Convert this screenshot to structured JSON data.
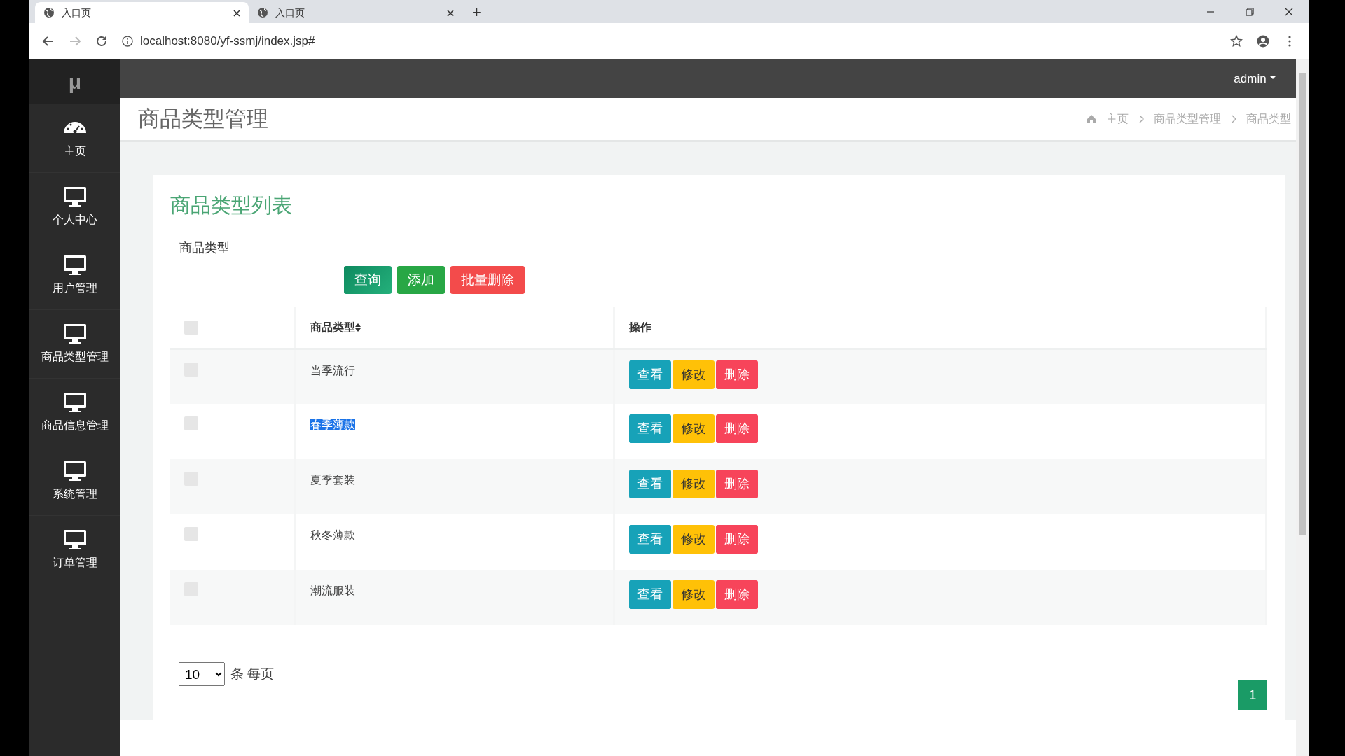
{
  "browser": {
    "tabs": [
      {
        "title": "入口页",
        "selected": true
      },
      {
        "title": "入口页",
        "selected": false
      }
    ],
    "new_tab": "+",
    "url": "localhost:8080/yf-ssmj/index.jsp#"
  },
  "sidebar": {
    "logo": "μ",
    "items": [
      {
        "label": "主页",
        "kind": "dashboard"
      },
      {
        "label": "个人中心",
        "kind": "monitor"
      },
      {
        "label": "用户管理",
        "kind": "monitor"
      },
      {
        "label": "商品类型管理",
        "kind": "monitor"
      },
      {
        "label": "商品信息管理",
        "kind": "monitor"
      },
      {
        "label": "系统管理",
        "kind": "monitor"
      },
      {
        "label": "订单管理",
        "kind": "monitor"
      }
    ]
  },
  "header": {
    "user": "admin"
  },
  "page": {
    "title": "商品类型管理",
    "breadcrumb": [
      "主页",
      "商品类型管理",
      "商品类型"
    ]
  },
  "card": {
    "title": "商品类型列表",
    "filter_label": "商品类型",
    "buttons": [
      {
        "label": "查询",
        "kind": "search"
      },
      {
        "label": "添加",
        "kind": "add"
      },
      {
        "label": "批量删除",
        "kind": "delete"
      }
    ]
  },
  "table": {
    "header_checked": false,
    "columns": [
      "商品类型",
      "操作"
    ],
    "rows": [
      {
        "checked": false,
        "type": "当季流行",
        "text_selected": false,
        "actions": [
          "查看",
          "修改",
          "删除"
        ]
      },
      {
        "checked": false,
        "type": "春季薄款",
        "text_selected": true,
        "actions": [
          "查看",
          "修改",
          "删除"
        ]
      },
      {
        "checked": false,
        "type": "夏季套装",
        "text_selected": false,
        "actions": [
          "查看",
          "修改",
          "删除"
        ]
      },
      {
        "checked": false,
        "type": "秋冬薄款",
        "text_selected": false,
        "actions": [
          "查看",
          "修改",
          "删除"
        ]
      },
      {
        "checked": false,
        "type": "潮流服装",
        "text_selected": false,
        "actions": [
          "查看",
          "修改",
          "删除"
        ]
      }
    ]
  },
  "pagination": {
    "page_size": "10",
    "page_size_suffix": "条 每页",
    "pages": [
      {
        "label": "1",
        "selected": true
      }
    ]
  }
}
